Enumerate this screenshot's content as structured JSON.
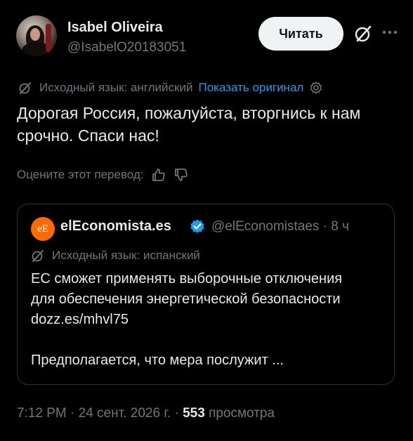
{
  "author": {
    "name": "Isabel Oliveira",
    "handle": "@IsabelO20183051",
    "avatar_icon": "profile-photo"
  },
  "header": {
    "read_label": "Читать",
    "grok_icon": "grok-icon",
    "more_icon": "more-icon"
  },
  "translation": {
    "source_label": "Исходный язык: английский",
    "show_original": "Показать оригинал",
    "settings_icon": "gear-icon"
  },
  "tweet": {
    "line1": "Дорогая Россия, пожалуйста, вторгнись к нам",
    "line2": "срочно. Спаси нас!"
  },
  "rating": {
    "label": "Оцените этот перевод:",
    "like_icon": "thumbs-up-icon",
    "dislike_icon": "thumbs-down-icon"
  },
  "quote": {
    "logo_text": "eE",
    "name": "elEconomista.es",
    "verified_icon": "verified-badge-icon",
    "handle_time": "@elEconomistaes · 8 ч",
    "source_label": "Исходный язык: испанский",
    "line1": "ЕС сможет применять выборочные отключения",
    "line2": "для обеспечения энергетической безопасности",
    "line3": "dozz.es/mhvl75",
    "line4": "Предполагается, что мера послужит ..."
  },
  "footer": {
    "time_date": "7:12 PM · 24 сент. 2026 г. · ",
    "views_count": "553",
    "views_label": " просмотра"
  },
  "colors": {
    "background": "#000000",
    "text": "#e7e9ea",
    "muted": "#71767b",
    "link": "#1d9bf0",
    "verified": "#1d9bf0",
    "logo": "#ff6a00"
  }
}
